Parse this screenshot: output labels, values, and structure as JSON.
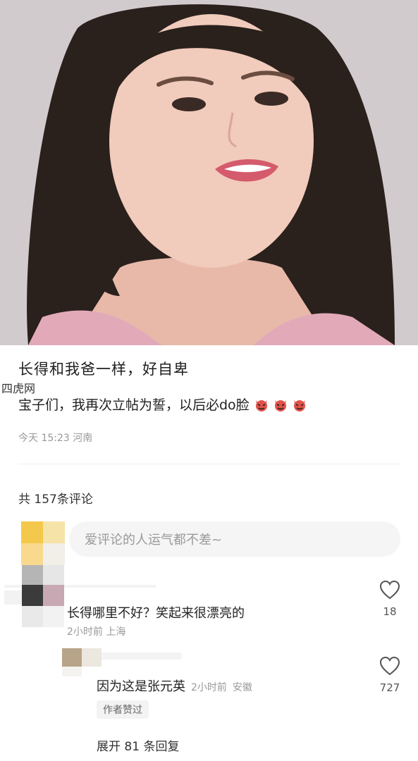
{
  "watermark": "四虎网",
  "post": {
    "title": "长得和我爸一样，好自卑",
    "body": "宝子们，我再次立帖为誓，以后必do脸",
    "time": "今天 15:23",
    "location": "河南",
    "emoji": "devil-face-emoji"
  },
  "comments_header": {
    "count_label": "共 157条评论"
  },
  "comment_input": {
    "placeholder": "爱评论的人运气都不差~"
  },
  "comments": [
    {
      "text": "长得哪里不好？笑起来很漂亮的",
      "time": "2小时前",
      "location": "上海",
      "likes": "18",
      "reply": {
        "text": "因为这是张元英",
        "time": "2小时前",
        "location": "安徽",
        "likes": "727",
        "badge": "作者赞过"
      },
      "expand_label": "展开 81 条回复"
    }
  ],
  "colors": {
    "like_outline": "#555555",
    "meta_gray": "#999999",
    "input_bg": "#f5f5f5"
  }
}
